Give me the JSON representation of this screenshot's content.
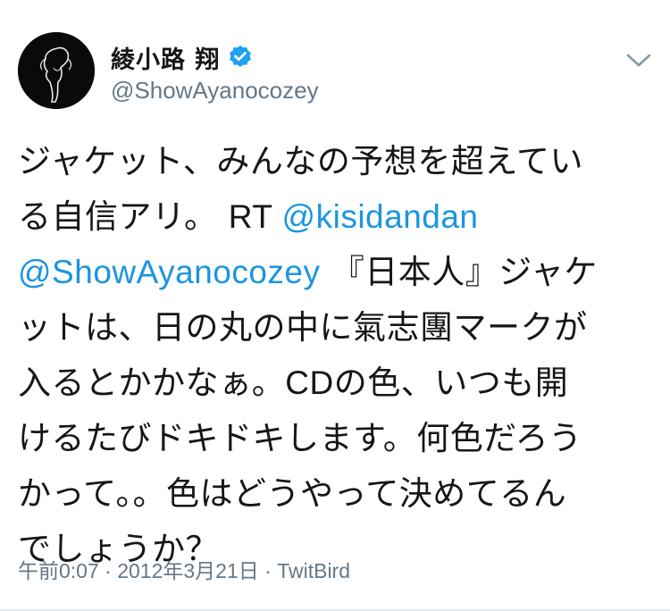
{
  "user": {
    "display_name": "綾小路 翔",
    "handle": "@ShowAyanocozey",
    "verified": true
  },
  "tweet": {
    "lines": [
      [
        {
          "t": "ジャケット、みんなの予想を超えてい"
        }
      ],
      [
        {
          "t": "る自信アリ。 "
        },
        {
          "t": "RT ",
          "latin": true
        },
        {
          "t": "@kisidandan",
          "mention": true
        }
      ],
      [
        {
          "t": "@ShowAyanocozey",
          "mention": true
        },
        {
          "t": " 『日本人』ジャケ"
        }
      ],
      [
        {
          "t": "ットは、日の丸の中に氣志團マークが"
        }
      ],
      [
        {
          "t": "入るとかかなぁ。"
        },
        {
          "t": "CD",
          "latin": true
        },
        {
          "t": "の色、いつも開"
        }
      ],
      [
        {
          "t": "けるたびドキドキします。何色だろう"
        }
      ],
      [
        {
          "t": "かって。。色はどうやって決めてるん"
        }
      ],
      [
        {
          "t": "でしょうか？"
        }
      ]
    ]
  },
  "meta": {
    "time": "午前0:07",
    "separator1": " · ",
    "date": "2012年3月21日",
    "separator2": " · ",
    "source": "TwitBird"
  },
  "icons": {
    "avatar": "avatar-silhouette-icon",
    "verified": "verified-badge-icon",
    "more": "chevron-down-icon"
  },
  "colors": {
    "link": "#1b95e0",
    "secondary": "#657786",
    "verified": "#1da1f2",
    "text": "#14171a"
  }
}
